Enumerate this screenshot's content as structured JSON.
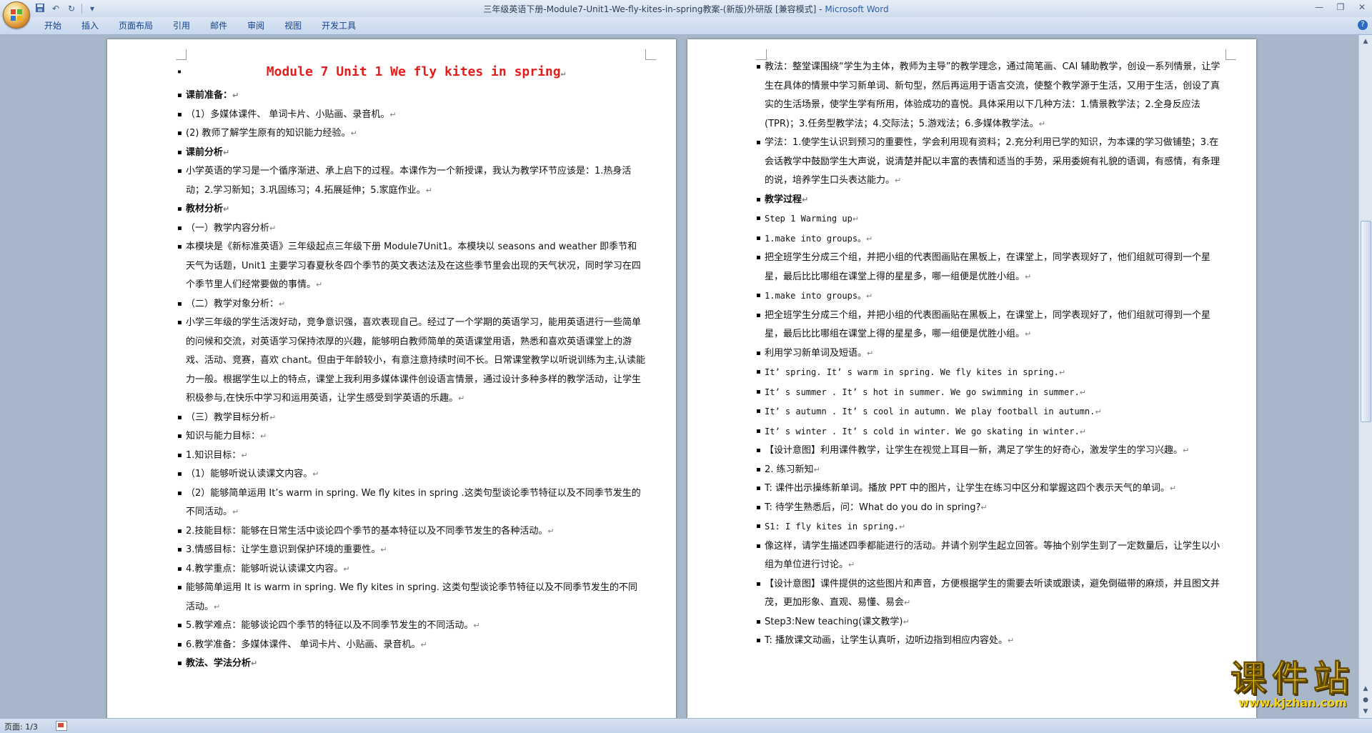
{
  "window": {
    "title": "三年级英语下册-Module7-Unit1-We-fly-kites-in-spring教案-(新版)外研版 [兼容模式] - ",
    "app_name": "Microsoft Word"
  },
  "ribbon": {
    "tabs": [
      "开始",
      "插入",
      "页面布局",
      "引用",
      "邮件",
      "审阅",
      "视图",
      "开发工具"
    ]
  },
  "status": {
    "page": "页面: 1/3"
  },
  "watermark": {
    "main": "课件站",
    "url": "www.kjzhan.com"
  },
  "left_page": {
    "title": "Module 7 Unit 1 We fly kites in spring",
    "paras": [
      {
        "text": "课前准备：",
        "bold": true
      },
      {
        "text": "（1）多媒体课件、 单词卡片、小贴画、录音机。"
      },
      {
        "text": "(2) 教师了解学生原有的知识能力经验。"
      },
      {
        "text": "课前分析",
        "bold": true
      },
      {
        "text": "小学英语的学习是一个循序渐进、承上启下的过程。本课作为一个新授课，我认为教学环节应该是：1.热身活动；2.学习新知；3.巩固练习；4.拓展延伸；5.家庭作业。"
      },
      {
        "text": "教材分析",
        "bold": true
      },
      {
        "text": "（一）教学内容分析"
      },
      {
        "text": "本模块是《新标准英语》三年级起点三年级下册 Module7Unit1。本模块以 seasons and weather 即季节和天气为话题，Unit1 主要学习春夏秋冬四个季节的英文表达法及在这些季节里会出现的天气状况，同时学习在四个季节里人们经常要做的事情。"
      },
      {
        "text": "（二）教学对象分析："
      },
      {
        "text": "小学三年级的学生活泼好动，竞争意识强，喜欢表现自己。经过了一个学期的英语学习，能用英语进行一些简单的问候和交流，对英语学习保持浓厚的兴趣，能够明白教师简单的英语课堂用语，熟悉和喜欢英语课堂上的游戏、活动、竞赛，喜欢 chant。但由于年龄较小，有意注意持续时间不长。日常课堂教学以听说训练为主,认读能力一般。根据学生以上的特点，课堂上我利用多媒体课件创设语言情景，通过设计多种多样的教学活动，让学生积极参与,在快乐中学习和运用英语，让学生感受到学英语的乐趣。"
      },
      {
        "text": "（三）教学目标分析"
      },
      {
        "text": "知识与能力目标："
      },
      {
        "text": "1.知识目标："
      },
      {
        "text": "（1）能够听说认读课文内容。"
      },
      {
        "text": "（2）能够简单运用 It’s warm in spring. We fly kites in spring .这类句型谈论季节特征以及不同季节发生的不同活动。"
      },
      {
        "text": "2.技能目标：能够在日常生活中谈论四个季节的基本特征以及不同季节发生的各种活动。"
      },
      {
        "text": "3.情感目标：让学生意识到保护环境的重要性。"
      },
      {
        "text": "4.教学重点：能够听说认读课文内容。"
      },
      {
        "text": "能够简单运用 It is warm in spring. We fly kites in spring. 这类句型谈论季节特征以及不同季节发生的不同活动。"
      },
      {
        "text": "5.教学难点：能够谈论四个季节的特征以及不同季节发生的不同活动。"
      },
      {
        "text": "6.教学准备：多媒体课件、 单词卡片、小贴画、录音机。"
      },
      {
        "text": "教法、学法分析",
        "bold": true
      }
    ]
  },
  "right_page": {
    "paras": [
      {
        "text": "教法：整堂课围绕“学生为主体，教师为主导”的教学理念，通过简笔画、CAI 辅助教学，创设一系列情景，让学生在具体的情景中学习新单词、新句型，然后再运用于语言交流，使整个教学源于生活，又用于生活，创设了真实的生活场景，使学生学有所用，体验成功的喜悦。具体采用以下几种方法：1.情景教学法；2.全身反应法(TPR)；3.任务型教学法；4.交际法；5.游戏法；6.多媒体教学法。"
      },
      {
        "text": "学法：1.使学生认识到预习的重要性，学会利用现有资料；2.充分利用已学的知识，为本课的学习做铺垫；3.在会话教学中鼓励学生大声说，说清楚并配以丰富的表情和适当的手势，采用委婉有礼貌的语调，有感情，有条理的说，培养学生口头表达能力。"
      },
      {
        "text": "教学过程",
        "bold": true
      },
      {
        "text": "Step 1 Warming up",
        "mono": true
      },
      {
        "text": "1.make into groups。",
        "mono": true
      },
      {
        "text": "把全班学生分成三个组，并把小组的代表图画贴在黑板上，在课堂上，同学表现好了，他们组就可得到一个星星，最后比比哪组在课堂上得的星星多，哪一组便是优胜小组。"
      },
      {
        "text": "1.make into groups。",
        "mono": true
      },
      {
        "text": "把全班学生分成三个组，并把小组的代表图画贴在黑板上，在课堂上，同学表现好了，他们组就可得到一个星星，最后比比哪组在课堂上得的星星多，哪一组便是优胜小组。"
      },
      {
        "text": "利用学习新单词及短语。"
      },
      {
        "text": "It’ spring. It’ s warm  in spring. We fly kites in spring.",
        "mono": true
      },
      {
        "text": "It’ s summer . It’ s hot in summer. We go swimming in summer.",
        "mono": true
      },
      {
        "text": "It’ s autumn .   It’ s cool  in autumn.  We play football in autumn.",
        "mono": true
      },
      {
        "text": "It’ s   winter  .    It’ s cold  in winter.   We go skating  in winter.",
        "mono": true
      },
      {
        "text": "【设计意图】利用课件教学，让学生在视觉上耳目一新，满足了学生的好奇心，激发学生的学习兴趣。"
      },
      {
        "text": "2. 练习新知"
      },
      {
        "text": "T: 课件出示操练新单词。播放 PPT 中的图片，让学生在练习中区分和掌握这四个表示天气的单词。"
      },
      {
        "text": "T: 待学生熟悉后，问：What do you do in spring?"
      },
      {
        "text": "S1: I fly kites in spring.",
        "mono": true
      },
      {
        "text": "像这样，请学生描述四季都能进行的活动。并请个别学生起立回答。等抽个别学生到了一定数量后，让学生以小组为单位进行讨论。"
      },
      {
        "text": "【设计意图】课件提供的这些图片和声音，方便根据学生的需要去听读或跟读，避免倒磁带的麻烦，并且图文并茂，更加形象、直观、易懂、易会"
      },
      {
        "text": "Step3:New teaching(课文教学)"
      },
      {
        "text": "T: 播放课文动画，让学生认真听，边听边指到相应内容处。"
      }
    ]
  }
}
